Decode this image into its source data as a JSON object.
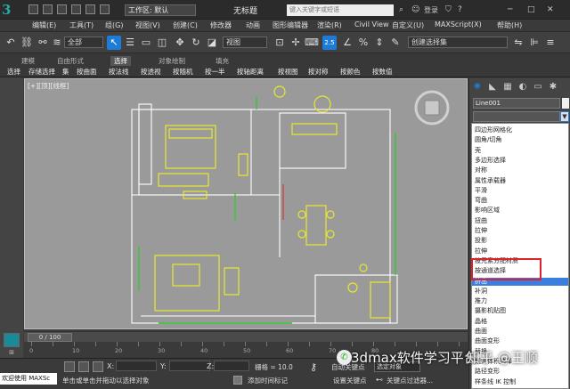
{
  "title_bar": {
    "logo": "3",
    "workspace_label": "工作区: 默认",
    "document_title": "无标题",
    "search_placeholder": "键入关键字或短语",
    "login_label": "登录"
  },
  "menu": [
    "编辑(E)",
    "工具(T)",
    "组(G)",
    "视图(V)",
    "创建(C)",
    "修改器",
    "动画",
    "图形编辑器",
    "渲染(R)",
    "Civil View",
    "自定义(U)",
    "MAXScript(X)",
    "帮助(H)"
  ],
  "main_toolbar": {
    "selection_filter": "全部",
    "reference_coords": "视图",
    "selection_set": "创建选择集",
    "snap_label": "2.5"
  },
  "ribbon": {
    "tabs": [
      "建模",
      "自由形式",
      "选择",
      "对象绘制",
      "填充"
    ],
    "active_tab": "选择",
    "buttons": [
      "选择",
      "存储选择",
      "集",
      "按曲面",
      "按法线",
      "按透视",
      "按随机",
      "按一半",
      "按轴距离",
      "按视图",
      "按对称",
      "按颜色",
      "按数值"
    ]
  },
  "viewport": {
    "label": "[+][顶][线框]"
  },
  "command_panel": {
    "tab_icons": [
      "create-icon",
      "modify-icon",
      "hierarchy-icon",
      "motion-icon",
      "display-icon",
      "utilities-icon"
    ],
    "object_name": "Line001",
    "object_color": "#f0f0f0",
    "modifier_list": [
      "四边形网格化",
      "圆角/切角",
      "壳",
      "多边形选择",
      "对称",
      "属性承载器",
      "平滑",
      "弯曲",
      "影响区域",
      "扭曲",
      "拉伸",
      "投影",
      "拉伸",
      "按元素分配材质",
      "按通道选择",
      "挤出",
      "补洞",
      "推力",
      "摄影机贴图",
      "晶格",
      "曲面",
      "曲面变形",
      "替换",
      "规则体积选择",
      "路径变形",
      "样条线 IK 控制"
    ],
    "selected_modifier": "挤出",
    "highlight_color": "#e0202a"
  },
  "time_slider": {
    "position": "0 / 100",
    "ticks": [
      "0",
      "10",
      "20",
      "30",
      "40",
      "50",
      "60",
      "70",
      "80"
    ]
  },
  "status": {
    "maxscript_label": "欢迎使用 MAXSc",
    "prompt": "单击或单击并拖动以选择对象",
    "x_label": "X:",
    "y_label": "Y:",
    "z_label": "Z:",
    "grid": "栅格 = 10.0",
    "add_time_tag": "添加时间标记",
    "auto_key": "自动关键点",
    "selection_set": "选定对象",
    "set_key": "设置关键点",
    "key_filter": "关键点过滤器..."
  },
  "watermarks": {
    "left": "3dmax软件学习平台",
    "right": "知乎 @王顺"
  }
}
